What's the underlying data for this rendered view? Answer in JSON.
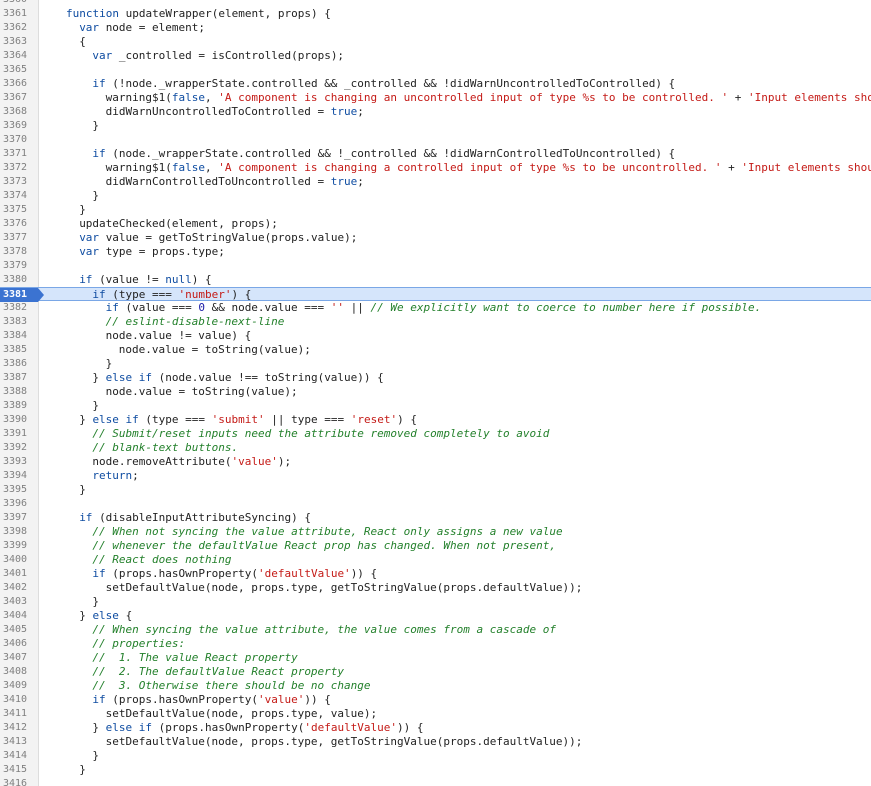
{
  "editor": {
    "highlight_line": "3381",
    "lines": [
      {
        "n": "3360",
        "indent": 0,
        "segs": []
      },
      {
        "n": "3361",
        "indent": 0,
        "segs": [
          {
            "t": "function ",
            "c": "kw"
          },
          {
            "t": "updateWrapper(element, props) {",
            "c": ""
          }
        ]
      },
      {
        "n": "3362",
        "indent": 1,
        "segs": [
          {
            "t": "var ",
            "c": "kw"
          },
          {
            "t": "node = element;",
            "c": ""
          }
        ]
      },
      {
        "n": "3363",
        "indent": 1,
        "segs": [
          {
            "t": "{",
            "c": ""
          }
        ]
      },
      {
        "n": "3364",
        "indent": 2,
        "segs": [
          {
            "t": "var ",
            "c": "kw"
          },
          {
            "t": "_controlled = isControlled(props);",
            "c": ""
          }
        ]
      },
      {
        "n": "3365",
        "indent": 0,
        "segs": []
      },
      {
        "n": "3366",
        "indent": 2,
        "segs": [
          {
            "t": "if ",
            "c": "kw"
          },
          {
            "t": "(!node._wrapperState.controlled && _controlled && !didWarnUncontrolledToControlled) {",
            "c": ""
          }
        ]
      },
      {
        "n": "3367",
        "indent": 3,
        "segs": [
          {
            "t": "warning$1(",
            "c": ""
          },
          {
            "t": "false",
            "c": "kw"
          },
          {
            "t": ", ",
            "c": ""
          },
          {
            "t": "'A component is changing an uncontrolled input of type %s to be controlled. '",
            "c": "str"
          },
          {
            "t": " + ",
            "c": ""
          },
          {
            "t": "'Input elements sho",
            "c": "str"
          }
        ]
      },
      {
        "n": "3368",
        "indent": 3,
        "segs": [
          {
            "t": "didWarnUncontrolledToControlled = ",
            "c": ""
          },
          {
            "t": "true",
            "c": "kw"
          },
          {
            "t": ";",
            "c": ""
          }
        ]
      },
      {
        "n": "3369",
        "indent": 2,
        "segs": [
          {
            "t": "}",
            "c": ""
          }
        ]
      },
      {
        "n": "3370",
        "indent": 0,
        "segs": []
      },
      {
        "n": "3371",
        "indent": 2,
        "segs": [
          {
            "t": "if ",
            "c": "kw"
          },
          {
            "t": "(node._wrapperState.controlled && !_controlled && !didWarnControlledToUncontrolled) {",
            "c": ""
          }
        ]
      },
      {
        "n": "3372",
        "indent": 3,
        "segs": [
          {
            "t": "warning$1(",
            "c": ""
          },
          {
            "t": "false",
            "c": "kw"
          },
          {
            "t": ", ",
            "c": ""
          },
          {
            "t": "'A component is changing a controlled input of type %s to be uncontrolled. '",
            "c": "str"
          },
          {
            "t": " + ",
            "c": ""
          },
          {
            "t": "'Input elements shou",
            "c": "str"
          }
        ]
      },
      {
        "n": "3373",
        "indent": 3,
        "segs": [
          {
            "t": "didWarnControlledToUncontrolled = ",
            "c": ""
          },
          {
            "t": "true",
            "c": "kw"
          },
          {
            "t": ";",
            "c": ""
          }
        ]
      },
      {
        "n": "3374",
        "indent": 2,
        "segs": [
          {
            "t": "}",
            "c": ""
          }
        ]
      },
      {
        "n": "3375",
        "indent": 1,
        "segs": [
          {
            "t": "}",
            "c": ""
          }
        ]
      },
      {
        "n": "3376",
        "indent": 1,
        "segs": [
          {
            "t": "updateChecked(element, props);",
            "c": ""
          }
        ]
      },
      {
        "n": "3377",
        "indent": 1,
        "segs": [
          {
            "t": "var ",
            "c": "kw"
          },
          {
            "t": "value = getToStringValue(props.value);",
            "c": ""
          }
        ]
      },
      {
        "n": "3378",
        "indent": 1,
        "segs": [
          {
            "t": "var ",
            "c": "kw"
          },
          {
            "t": "type = props.type;",
            "c": ""
          }
        ]
      },
      {
        "n": "3379",
        "indent": 0,
        "segs": []
      },
      {
        "n": "3380",
        "indent": 1,
        "segs": [
          {
            "t": "if ",
            "c": "kw"
          },
          {
            "t": "(value != ",
            "c": ""
          },
          {
            "t": "null",
            "c": "kw"
          },
          {
            "t": ") {",
            "c": ""
          }
        ]
      },
      {
        "n": "3381",
        "indent": 2,
        "segs": [
          {
            "t": "if ",
            "c": "kw"
          },
          {
            "t": "(type === ",
            "c": ""
          },
          {
            "t": "'number'",
            "c": "str"
          },
          {
            "t": ") {",
            "c": ""
          }
        ]
      },
      {
        "n": "3382",
        "indent": 3,
        "segs": [
          {
            "t": "if ",
            "c": "kw"
          },
          {
            "t": "(value === ",
            "c": ""
          },
          {
            "t": "0",
            "c": "num"
          },
          {
            "t": " && node.value === ",
            "c": ""
          },
          {
            "t": "''",
            "c": "str"
          },
          {
            "t": " || ",
            "c": ""
          },
          {
            "t": "// We explicitly want to coerce to number here if possible.",
            "c": "cm"
          }
        ]
      },
      {
        "n": "3383",
        "indent": 3,
        "segs": [
          {
            "t": "// eslint-disable-next-line",
            "c": "cm"
          }
        ]
      },
      {
        "n": "3384",
        "indent": 3,
        "segs": [
          {
            "t": "node.value != value) {",
            "c": ""
          }
        ]
      },
      {
        "n": "3385",
        "indent": 4,
        "segs": [
          {
            "t": "node.value = toString(value);",
            "c": ""
          }
        ]
      },
      {
        "n": "3386",
        "indent": 3,
        "segs": [
          {
            "t": "}",
            "c": ""
          }
        ]
      },
      {
        "n": "3387",
        "indent": 2,
        "segs": [
          {
            "t": "} ",
            "c": ""
          },
          {
            "t": "else if ",
            "c": "kw"
          },
          {
            "t": "(node.value !== toString(value)) {",
            "c": ""
          }
        ]
      },
      {
        "n": "3388",
        "indent": 3,
        "segs": [
          {
            "t": "node.value = toString(value);",
            "c": ""
          }
        ]
      },
      {
        "n": "3389",
        "indent": 2,
        "segs": [
          {
            "t": "}",
            "c": ""
          }
        ]
      },
      {
        "n": "3390",
        "indent": 1,
        "segs": [
          {
            "t": "} ",
            "c": ""
          },
          {
            "t": "else if ",
            "c": "kw"
          },
          {
            "t": "(type === ",
            "c": ""
          },
          {
            "t": "'submit'",
            "c": "str"
          },
          {
            "t": " || type === ",
            "c": ""
          },
          {
            "t": "'reset'",
            "c": "str"
          },
          {
            "t": ") {",
            "c": ""
          }
        ]
      },
      {
        "n": "3391",
        "indent": 2,
        "segs": [
          {
            "t": "// Submit/reset inputs need the attribute removed completely to avoid",
            "c": "cm"
          }
        ]
      },
      {
        "n": "3392",
        "indent": 2,
        "segs": [
          {
            "t": "// blank-text buttons.",
            "c": "cm"
          }
        ]
      },
      {
        "n": "3393",
        "indent": 2,
        "segs": [
          {
            "t": "node.removeAttribute(",
            "c": ""
          },
          {
            "t": "'value'",
            "c": "str"
          },
          {
            "t": ");",
            "c": ""
          }
        ]
      },
      {
        "n": "3394",
        "indent": 2,
        "segs": [
          {
            "t": "return",
            "c": "kw"
          },
          {
            "t": ";",
            "c": ""
          }
        ]
      },
      {
        "n": "3395",
        "indent": 1,
        "segs": [
          {
            "t": "}",
            "c": ""
          }
        ]
      },
      {
        "n": "3396",
        "indent": 0,
        "segs": []
      },
      {
        "n": "3397",
        "indent": 1,
        "segs": [
          {
            "t": "if ",
            "c": "kw"
          },
          {
            "t": "(disableInputAttributeSyncing) {",
            "c": ""
          }
        ]
      },
      {
        "n": "3398",
        "indent": 2,
        "segs": [
          {
            "t": "// When not syncing the value attribute, React only assigns a new value",
            "c": "cm"
          }
        ]
      },
      {
        "n": "3399",
        "indent": 2,
        "segs": [
          {
            "t": "// whenever the defaultValue React prop has changed. When not present,",
            "c": "cm"
          }
        ]
      },
      {
        "n": "3400",
        "indent": 2,
        "segs": [
          {
            "t": "// React does nothing",
            "c": "cm"
          }
        ]
      },
      {
        "n": "3401",
        "indent": 2,
        "segs": [
          {
            "t": "if ",
            "c": "kw"
          },
          {
            "t": "(props.hasOwnProperty(",
            "c": ""
          },
          {
            "t": "'defaultValue'",
            "c": "str"
          },
          {
            "t": ")) {",
            "c": ""
          }
        ]
      },
      {
        "n": "3402",
        "indent": 3,
        "segs": [
          {
            "t": "setDefaultValue(node, props.type, getToStringValue(props.defaultValue));",
            "c": ""
          }
        ]
      },
      {
        "n": "3403",
        "indent": 2,
        "segs": [
          {
            "t": "}",
            "c": ""
          }
        ]
      },
      {
        "n": "3404",
        "indent": 1,
        "segs": [
          {
            "t": "} ",
            "c": ""
          },
          {
            "t": "else ",
            "c": "kw"
          },
          {
            "t": "{",
            "c": ""
          }
        ]
      },
      {
        "n": "3405",
        "indent": 2,
        "segs": [
          {
            "t": "// When syncing the value attribute, the value comes from a cascade of",
            "c": "cm"
          }
        ]
      },
      {
        "n": "3406",
        "indent": 2,
        "segs": [
          {
            "t": "// properties:",
            "c": "cm"
          }
        ]
      },
      {
        "n": "3407",
        "indent": 2,
        "segs": [
          {
            "t": "//  1. The value React property",
            "c": "cm"
          }
        ]
      },
      {
        "n": "3408",
        "indent": 2,
        "segs": [
          {
            "t": "//  2. The defaultValue React property",
            "c": "cm"
          }
        ]
      },
      {
        "n": "3409",
        "indent": 2,
        "segs": [
          {
            "t": "//  3. Otherwise there should be no change",
            "c": "cm"
          }
        ]
      },
      {
        "n": "3410",
        "indent": 2,
        "segs": [
          {
            "t": "if ",
            "c": "kw"
          },
          {
            "t": "(props.hasOwnProperty(",
            "c": ""
          },
          {
            "t": "'value'",
            "c": "str"
          },
          {
            "t": ")) {",
            "c": ""
          }
        ]
      },
      {
        "n": "3411",
        "indent": 3,
        "segs": [
          {
            "t": "setDefaultValue(node, props.type, value);",
            "c": ""
          }
        ]
      },
      {
        "n": "3412",
        "indent": 2,
        "segs": [
          {
            "t": "} ",
            "c": ""
          },
          {
            "t": "else if ",
            "c": "kw"
          },
          {
            "t": "(props.hasOwnProperty(",
            "c": ""
          },
          {
            "t": "'defaultValue'",
            "c": "str"
          },
          {
            "t": ")) {",
            "c": ""
          }
        ]
      },
      {
        "n": "3413",
        "indent": 3,
        "segs": [
          {
            "t": "setDefaultValue(node, props.type, getToStringValue(props.defaultValue));",
            "c": ""
          }
        ]
      },
      {
        "n": "3414",
        "indent": 2,
        "segs": [
          {
            "t": "}",
            "c": ""
          }
        ]
      },
      {
        "n": "3415",
        "indent": 1,
        "segs": [
          {
            "t": "}",
            "c": ""
          }
        ]
      },
      {
        "n": "3416",
        "indent": 0,
        "segs": []
      }
    ]
  }
}
